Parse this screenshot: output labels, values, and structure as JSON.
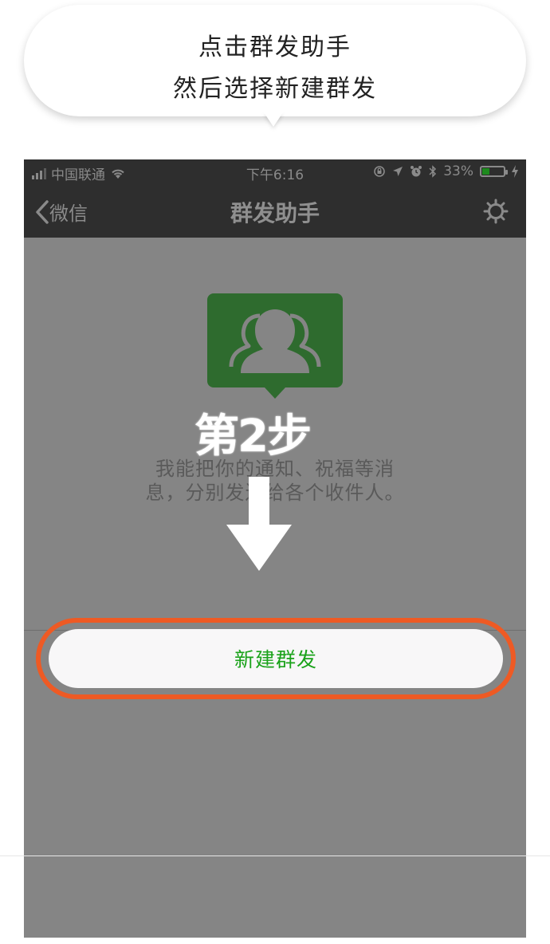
{
  "instruction": {
    "line1": "点击群发助手",
    "line2": "然后选择新建群发"
  },
  "status_bar": {
    "carrier": "中国联通",
    "time": "下午6:16",
    "battery_percent": "33%",
    "battery_level": 0.33
  },
  "nav_bar": {
    "back_label": "微信",
    "title": "群发助手",
    "settings_icon": "gear-icon"
  },
  "main": {
    "description_line1": "我能把你的通知、祝福等消",
    "description_line2": "息，分别发送给各个收件人。",
    "new_broadcast_label": "新建群发"
  },
  "overlay": {
    "step_label": "第2步"
  },
  "colors": {
    "nav_bg": "#2e2e2e",
    "dim_bg": "#858585",
    "icon_green": "#2e6b2e",
    "highlight_orange": "#ee5a24",
    "button_text_green": "#1aa21a"
  }
}
